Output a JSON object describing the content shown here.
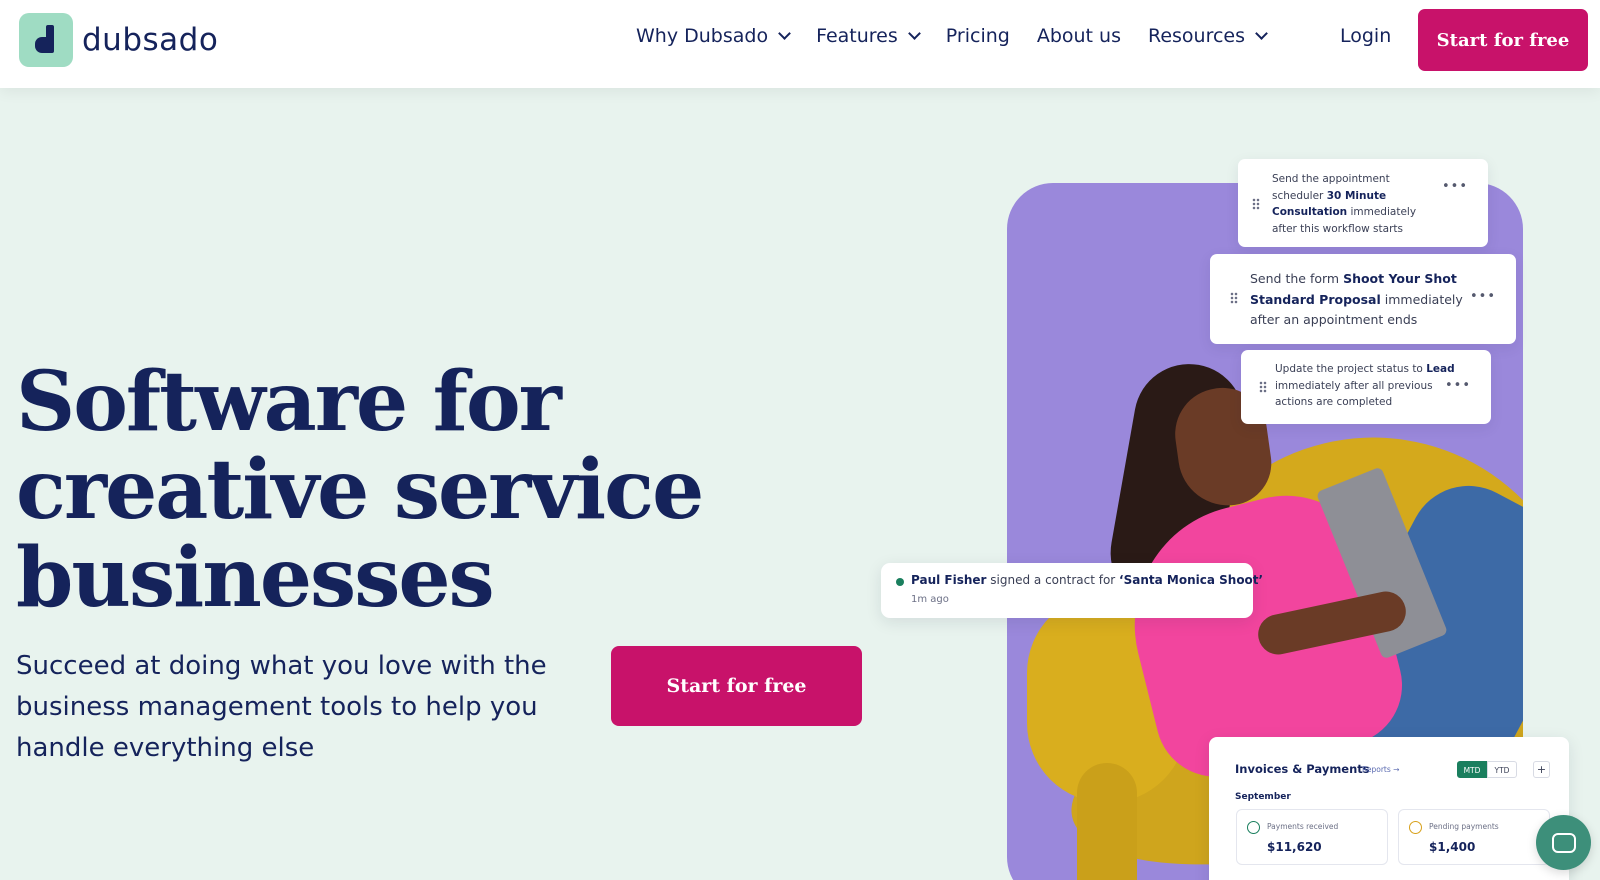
{
  "brand": {
    "name": "dubsado",
    "accent": "#c8126a",
    "logo_bg": "#9fdcc3",
    "navy": "#15235b"
  },
  "nav": {
    "items": [
      {
        "label": "Why Dubsado",
        "dropdown": true
      },
      {
        "label": "Features",
        "dropdown": true
      },
      {
        "label": "Pricing",
        "dropdown": false
      },
      {
        "label": "About us",
        "dropdown": false
      },
      {
        "label": "Resources",
        "dropdown": true
      }
    ],
    "login": "Login",
    "cta": "Start for free"
  },
  "hero": {
    "headline": "Software for creative service businesses",
    "subtext": "Succeed at doing what you love with the business management tools to help you handle everything else",
    "cta": "Start for free"
  },
  "workflow_cards": [
    {
      "pre": "Send the appointment scheduler ",
      "bold": "30 Minute Consultation",
      "post": " immediately after this workflow starts"
    },
    {
      "pre": "Send the form ",
      "bold": "Shoot Your Shot Standard Proposal",
      "post": " immediately after an appointment ends"
    },
    {
      "pre": "Update the project status to ",
      "bold": "Lead",
      "post": " immediately after all previous actions are completed"
    }
  ],
  "notification": {
    "name": "Paul Fisher",
    "action": " signed a contract for ",
    "item": "‘Santa Monica Shoot’",
    "time": "1m ago"
  },
  "invoices": {
    "title": "Invoices & Payments",
    "reports": "Reports →",
    "toggle": [
      "MTD",
      "YTD"
    ],
    "plus": "+",
    "month": "September",
    "tiles": [
      {
        "label": "Payments received",
        "value": "$11,620",
        "icon": "check-circle-icon"
      },
      {
        "label": "Pending payments",
        "value": "$1,400",
        "icon": "clock-icon"
      }
    ]
  }
}
